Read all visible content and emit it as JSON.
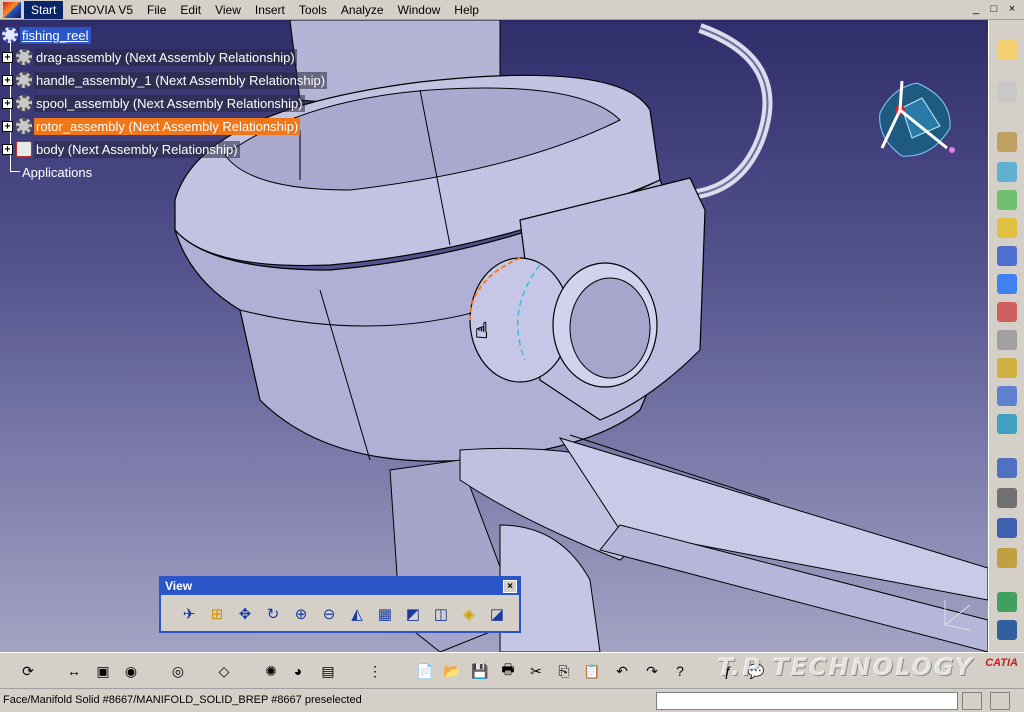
{
  "menu": {
    "items": [
      "Start",
      "ENOVIA V5",
      "File",
      "Edit",
      "View",
      "Insert",
      "Tools",
      "Analyze",
      "Window",
      "Help"
    ],
    "active_index": 0
  },
  "window_controls": [
    "_",
    "□",
    "×"
  ],
  "tree": {
    "root": "fishing_reel",
    "children": [
      "drag-assembly (Next Assembly Relationship)",
      "handle_assembly_1 (Next Assembly Relationship)",
      "spool_assembly (Next Assembly Relationship)",
      "rotor_assembly (Next Assembly Relationship)",
      "body (Next Assembly Relationship)"
    ],
    "selected_index": 3,
    "applications": "Applications"
  },
  "view_toolbar": {
    "title": "View",
    "close": "×",
    "buttons": [
      "fly-mode",
      "fit-all-in",
      "pan",
      "rotate",
      "zoom-in",
      "zoom-out",
      "normal-view",
      "multi-view",
      "quick-view",
      "view-mode",
      "hide-show",
      "swap-visible-space"
    ]
  },
  "colors": {
    "accent": "#2a56c8",
    "selection": "#f07818",
    "background": "#d4d0c8"
  },
  "watermark": "T.P TECHNOLOGY",
  "brand": "CATIA",
  "status": {
    "text": "Face/Manifold Solid #8667/MANIFOLD_SOLID_BREP #8667 preselected"
  }
}
